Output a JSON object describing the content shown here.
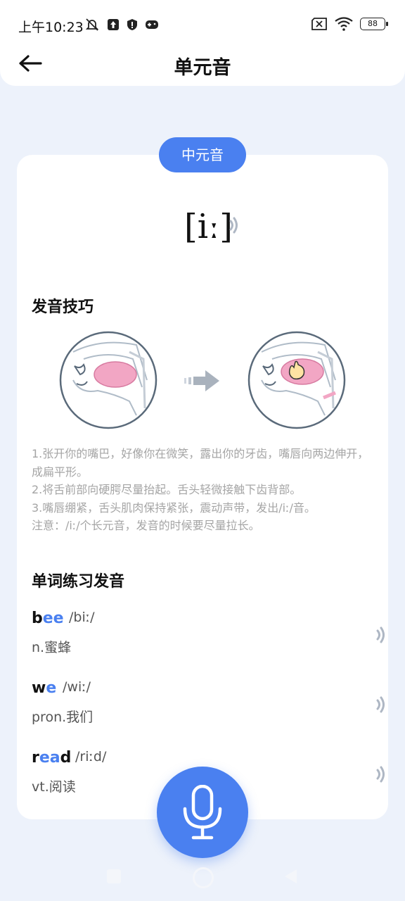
{
  "status_bar": {
    "time": "上午10:23",
    "battery": "88"
  },
  "header": {
    "title": "单元音"
  },
  "card": {
    "category": "中元音",
    "phonetic": "[iː]",
    "section_tips_title": "发音技巧",
    "tips": [
      "1.张开你的嘴巴，好像你在微笑，露出你的牙齿，嘴唇向两边伸开，成扁平形。",
      "2.将舌前部向硬腭尽量抬起。舌头轻微接触下齿背部。",
      "3.嘴唇绷紧，舌头肌肉保持紧张，震动声带，发出/iː/音。",
      "注意：/iː/个长元音，发音的时候要尽量拉长。"
    ],
    "section_words_title": "单词练习发音",
    "words": [
      {
        "pre": "b",
        "hl": "ee",
        "post": "",
        "ipa": "/biː/",
        "meaning": "n.蜜蜂"
      },
      {
        "pre": "w",
        "hl": "e",
        "post": "",
        "ipa": "/wiː/",
        "meaning": "pron.我们"
      },
      {
        "pre": "r",
        "hl": "ea",
        "post": "d",
        "ipa": "/riːd/",
        "meaning": "vt.阅读"
      }
    ]
  },
  "colors": {
    "accent": "#4a80f0",
    "background": "#edf2fb",
    "tip_text": "#a5a5a5"
  },
  "icons": [
    "back-arrow-icon",
    "speaker-icon",
    "microphone-icon",
    "mouth-diagram-icon",
    "arrow-right-icon"
  ]
}
